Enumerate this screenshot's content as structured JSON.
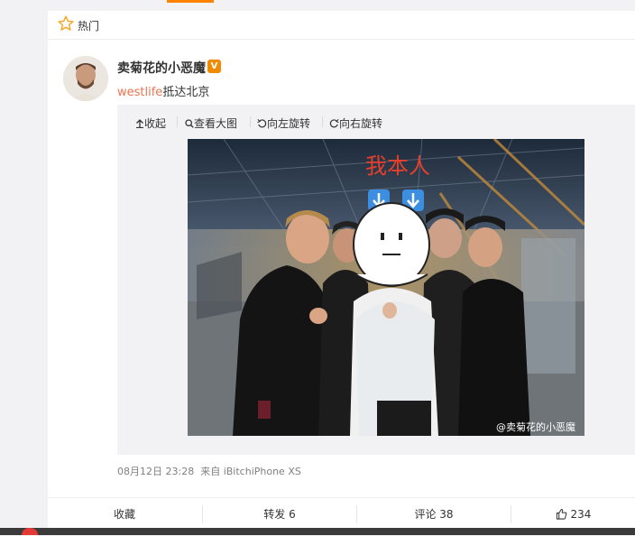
{
  "feed": {
    "section_label": "热门"
  },
  "post": {
    "author_name": "卖菊花的小恶魔",
    "topic": "westlife",
    "text": "抵达北京",
    "timestamp": "08月12日 23:28",
    "source": "来自 iBitchiPhone XS"
  },
  "media_toolbar": {
    "collapse": "收起",
    "view_large": "查看大图",
    "rotate_left": "向左旋转",
    "rotate_right": "向右旋转"
  },
  "photo": {
    "overlay_caption": "我本人",
    "watermark": "@卖菊花的小恶魔"
  },
  "actions": {
    "favorite": "收藏",
    "repost": "转发 6",
    "comment": "评论 38",
    "like": "234"
  },
  "colors": {
    "accent": "#ff8200",
    "link": "#eb7350",
    "verified": "#f08a00"
  }
}
